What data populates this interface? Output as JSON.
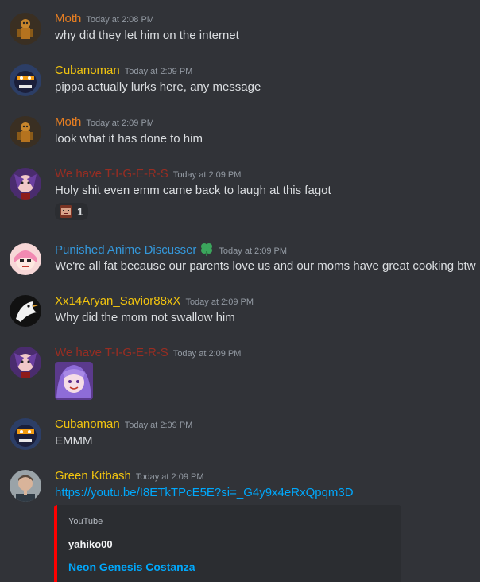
{
  "colors": {
    "background": "#313338",
    "moth": "#e67e22",
    "cubanoman": "#f1c40f",
    "tigers": "#992d22",
    "punished": "#3498db",
    "aryan": "#f1c40f",
    "green_kitbash": "#f1c40f",
    "link": "#00a8fc",
    "embed_bar": "#ff0000"
  },
  "messages": [
    {
      "username": "Moth",
      "timestamp": "Today at 2:08 PM",
      "text": "why did they let him on the internet",
      "avatar": "moth-avatar-icon"
    },
    {
      "username": "Cubanoman",
      "timestamp": "Today at 2:09 PM",
      "text": "pippa actually lurks here, any message",
      "avatar": "cubanoman-avatar-icon"
    },
    {
      "username": "Moth",
      "timestamp": "Today at 2:09 PM",
      "text": "look what it has done to him",
      "avatar": "moth-avatar-icon"
    },
    {
      "username": "We have T-I-G-E-R-S",
      "timestamp": "Today at 2:09 PM",
      "text": "Holy shit even emm came back to laugh at this fagot",
      "avatar": "tigers-avatar-icon",
      "reaction": {
        "emoji": "face-emoji-icon",
        "count": "1"
      }
    },
    {
      "username": "Punished Anime Discusser",
      "timestamp": "Today at 2:09 PM",
      "text": "We're all fat because our parents love us and our moms have great cooking btw",
      "avatar": "anime-girl-avatar-icon",
      "badge": "clover-badge-icon"
    },
    {
      "username": "Xx14Aryan_Savior88xX",
      "timestamp": "Today at 2:09 PM",
      "text": "Why did the mom not swallow him",
      "avatar": "bird-avatar-icon"
    },
    {
      "username": "We have T-I-G-E-R-S",
      "timestamp": "Today at 2:09 PM",
      "avatar": "tigers-avatar-icon",
      "sticker": "purple-hair-girl-sticker-icon"
    },
    {
      "username": "Cubanoman",
      "timestamp": "Today at 2:09 PM",
      "text": "EMMM",
      "avatar": "cubanoman-avatar-icon"
    },
    {
      "username": "Green Kitbash",
      "timestamp": "Today at 2:09 PM",
      "link": "https://youtu.be/I8ETkTPcE5E?si=_G4y9x4eRxQpqm3D",
      "avatar": "man-portrait-avatar-icon",
      "embed": {
        "provider": "YouTube",
        "author": "yahiko00",
        "title": "Neon Genesis Costanza"
      }
    }
  ]
}
